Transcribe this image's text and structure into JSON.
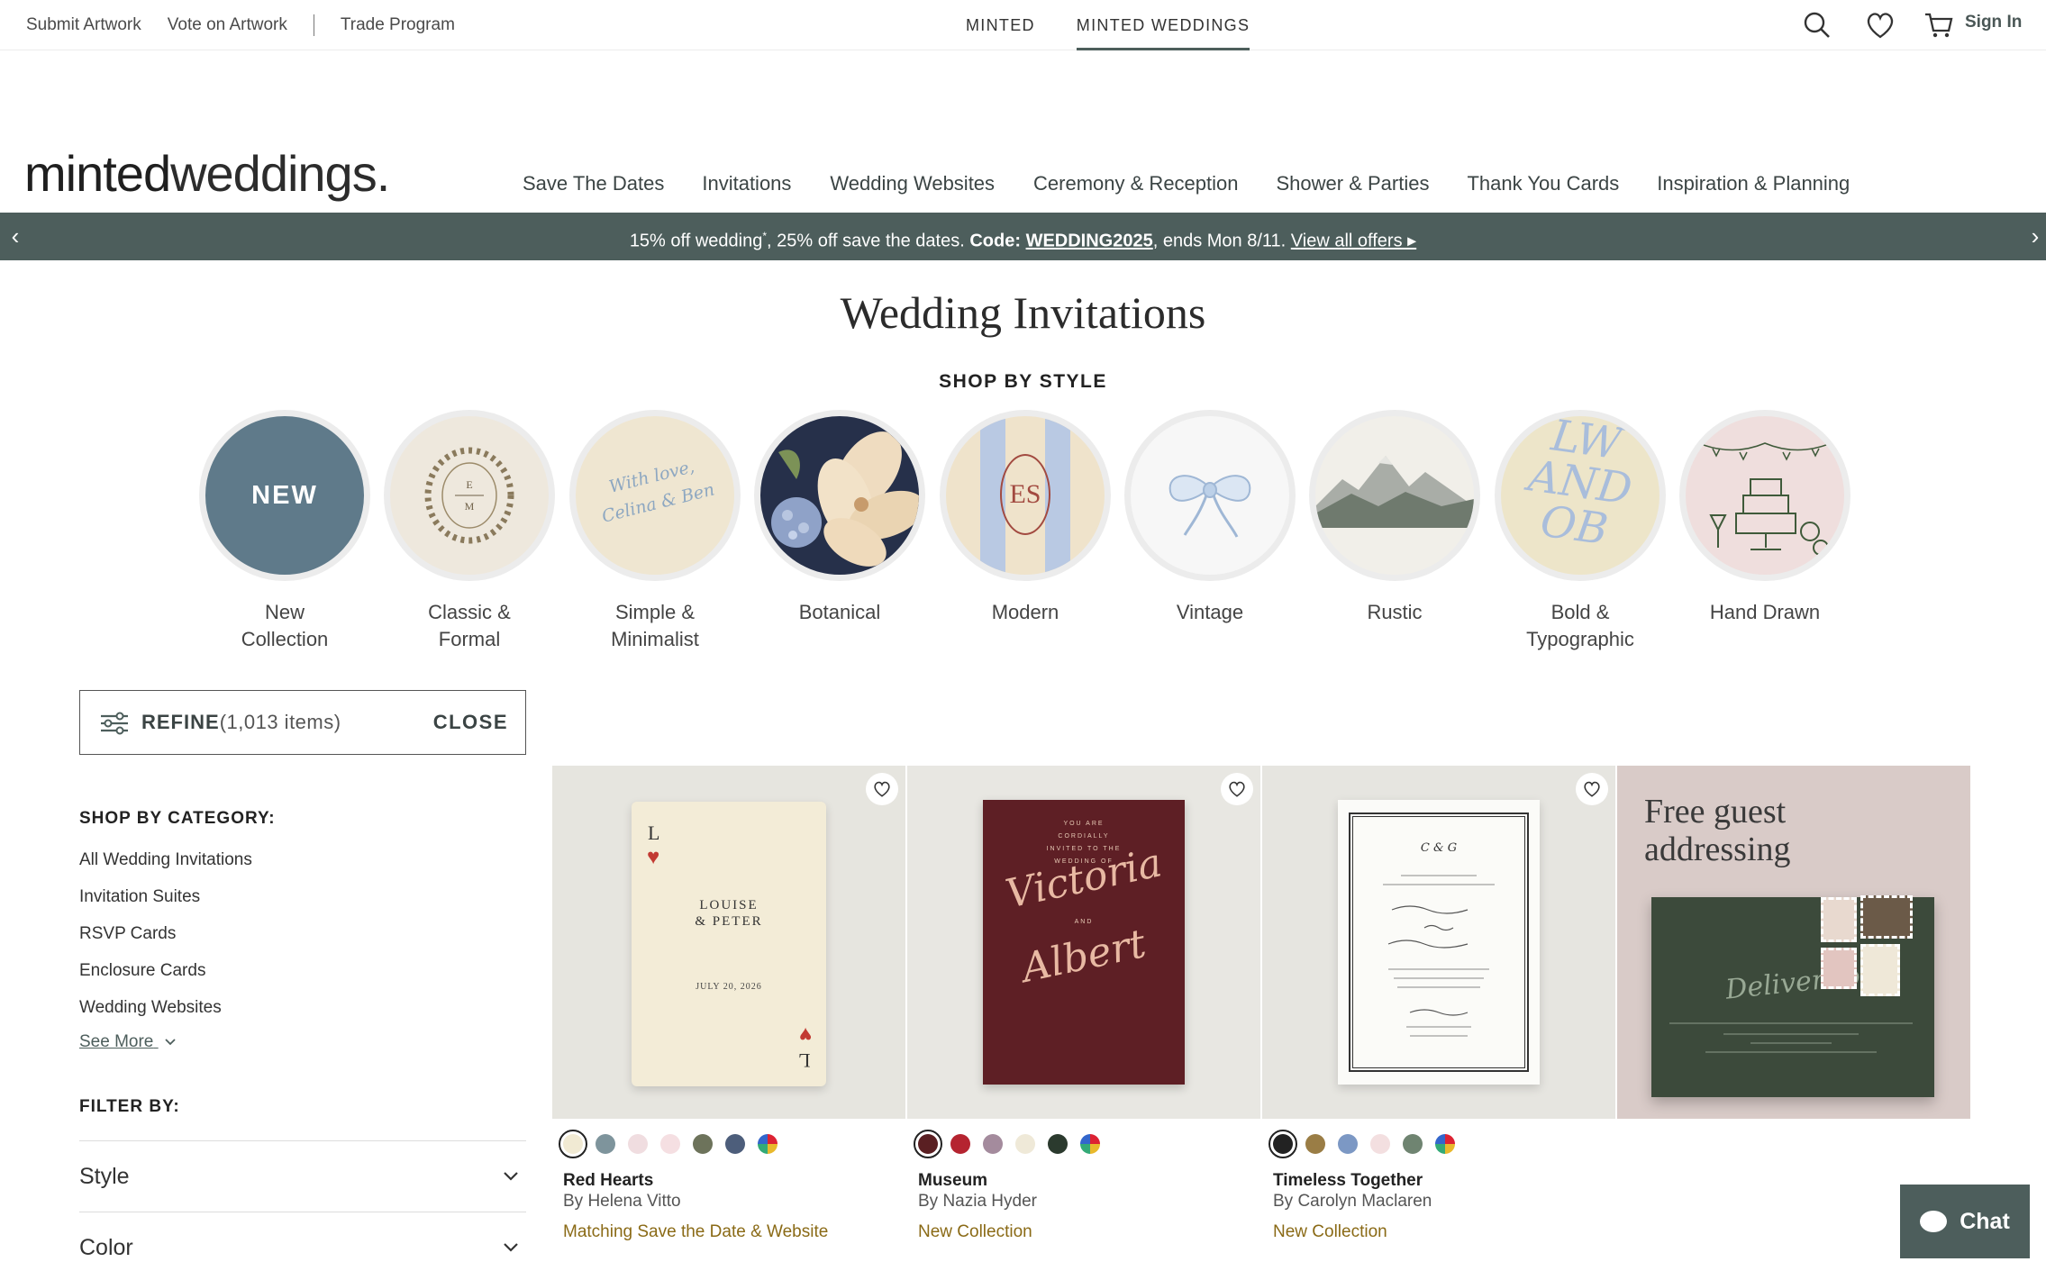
{
  "utility": {
    "submit": "Submit Artwork",
    "vote": "Vote on Artwork",
    "trade": "Trade Program",
    "minted": "MINTED",
    "weddings": "MINTED WEDDINGS",
    "sign_in": "Sign In"
  },
  "logo": {
    "bold": "minted",
    "thin": "weddings."
  },
  "nav": [
    "Save The Dates",
    "Invitations",
    "Wedding Websites",
    "Ceremony & Reception",
    "Shower & Parties",
    "Thank You Cards",
    "Inspiration & Planning"
  ],
  "promo": {
    "part1": "15% off wedding",
    "sup": "*",
    "part2": ", 25% off save the dates. ",
    "code_label": "Code: ",
    "code": "WEDDING2025",
    "part3": ", ends Mon 8/11. ",
    "link": "View all offers ▸",
    "color": "#4d5e5c"
  },
  "page_title": "Wedding Invitations",
  "shop_by_style": "SHOP BY STYLE",
  "styles": [
    {
      "line1": "New",
      "line2": "Collection",
      "badge": "NEW"
    },
    {
      "line1": "Classic &",
      "line2": "Formal"
    },
    {
      "line1": "Simple &",
      "line2": "Minimalist",
      "script": "With love, Celina & Ben"
    },
    {
      "line1": "Botanical",
      "line2": ""
    },
    {
      "line1": "Modern",
      "line2": "",
      "mono": "ES"
    },
    {
      "line1": "Vintage",
      "line2": ""
    },
    {
      "line1": "Rustic",
      "line2": ""
    },
    {
      "line1": "Bold &",
      "line2": "Typographic",
      "letters": "LW AND OB"
    },
    {
      "line1": "Hand Drawn",
      "line2": ""
    }
  ],
  "refine": {
    "label": "REFINE",
    "count": "(1,013 items)",
    "close": "CLOSE"
  },
  "sidebar": {
    "category_heading": "SHOP BY CATEGORY:",
    "categories": [
      "All Wedding Invitations",
      "Invitation Suites",
      "RSVP Cards",
      "Enclosure Cards",
      "Wedding Websites"
    ],
    "see_more": "See More",
    "filter_heading": "FILTER BY:",
    "filters": [
      "Style",
      "Color"
    ]
  },
  "products": [
    {
      "name": "Red Hearts",
      "by": "By Helena Vitto",
      "tag": "Matching Save the Date & Website",
      "card": {
        "names": "LOUISE & PETER",
        "date": "JULY 20, 2026",
        "corner": "L"
      },
      "swatches": [
        "#f1ead3",
        "#7e949c",
        "#f0dde0",
        "#f5dfe2",
        "#6d735b",
        "#4d5e7b",
        "multi"
      ]
    },
    {
      "name": "Museum",
      "by": "By Nazia Hyder",
      "tag": "New Collection",
      "card": {
        "top": "YOU ARE CORDIALLY INVITED TO THE WEDDING OF",
        "name1": "Victoria",
        "and": "AND",
        "name2": "Albert"
      },
      "swatches": [
        "#5a1f22",
        "#b52430",
        "#a48b9d",
        "#efe9d8",
        "#2b3a2e",
        "multi"
      ]
    },
    {
      "name": "Timeless Together",
      "by": "By Carolyn Maclaren",
      "tag": "New Collection",
      "card": {
        "mono": "C & G"
      },
      "swatches": [
        "#222222",
        "#9a7d45",
        "#7c98c4",
        "#f3dfe0",
        "#6f8471",
        "multi"
      ]
    }
  ],
  "promo_tile": {
    "title": "Free guest addressing",
    "script": "Deliver to"
  },
  "chat": "Chat"
}
